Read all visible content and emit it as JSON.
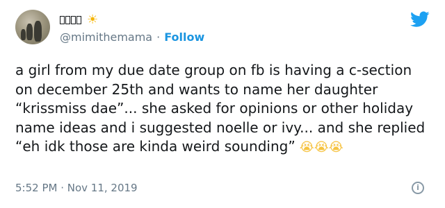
{
  "tweet": {
    "display_name": "□□□□",
    "handle": "@mimithemama",
    "separator": "·",
    "follow_label": "Follow",
    "text": "a girl from my due date group on fb is having a c-section on december 25th and wants to name her daughter “krissmiss dae”... she asked for opinions or other holiday name ideas and i suggested noelle or ivy... and she replied “eh idk those are kinda weird sounding”",
    "emoji": "😭😭😭",
    "timestamp": "5:52 PM · Nov 11, 2019",
    "icons": {
      "avatar": "avatar",
      "badge": "sun-emoji-icon",
      "platform": "twitter-bird-icon",
      "info": "info-icon"
    },
    "colors": {
      "link": "#1b95e0",
      "secondary": "#657786",
      "text": "#14171a"
    }
  }
}
